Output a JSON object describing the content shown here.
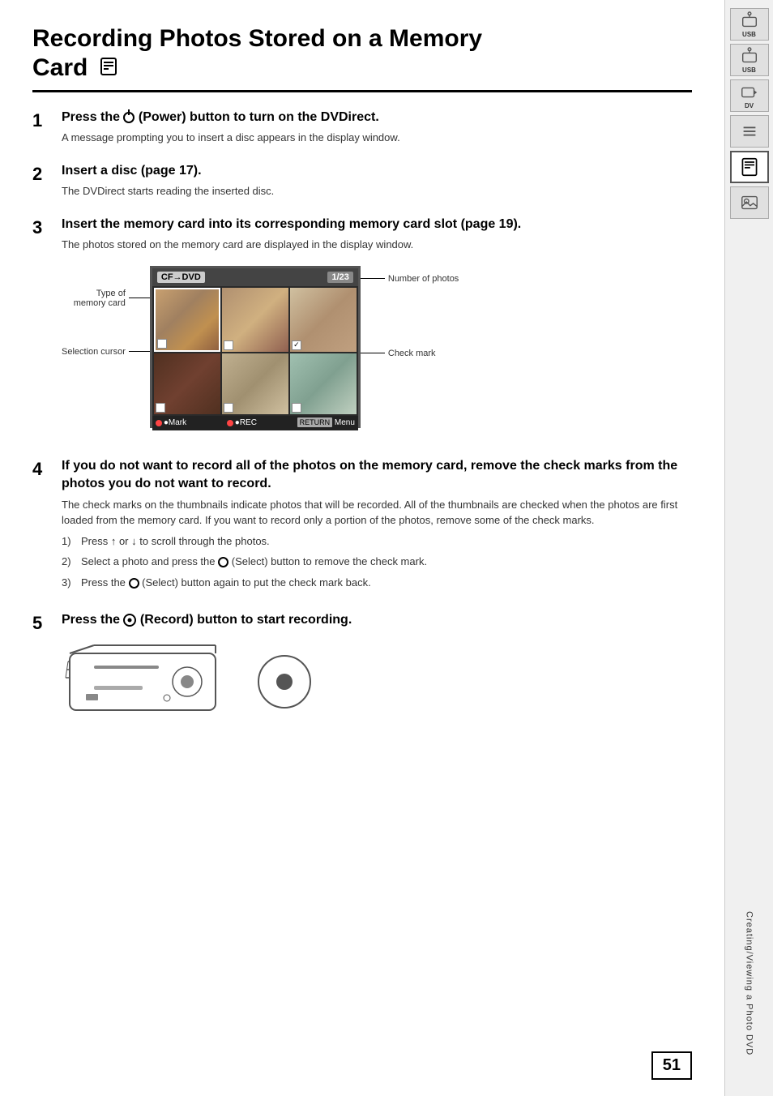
{
  "page": {
    "title_line1": "Recording Photos Stored on a Memory",
    "title_line2": "Card",
    "page_number": "51"
  },
  "sidebar": {
    "icons": [
      {
        "id": "usb-top",
        "label": "USB",
        "active": false
      },
      {
        "id": "usb-bottom",
        "label": "USB",
        "active": false
      },
      {
        "id": "dv",
        "label": "DV",
        "active": false
      },
      {
        "id": "lines",
        "label": "",
        "active": false
      },
      {
        "id": "card",
        "label": "",
        "active": true
      },
      {
        "id": "photo",
        "label": "",
        "active": false
      }
    ],
    "vertical_text": "Creating/Viewing a Photo DVD"
  },
  "steps": [
    {
      "number": "1",
      "heading": "Press the ⓨ (Power) button to turn on the DVDirect.",
      "description": "A message prompting you to insert a disc appears in the display window."
    },
    {
      "number": "2",
      "heading": "Insert a disc (page 17).",
      "description": "The DVDirect starts reading the inserted disc."
    },
    {
      "number": "3",
      "heading": "Insert the memory card into its corresponding memory card slot (page 19).",
      "description": "The photos stored on the memory card are displayed in the display window."
    },
    {
      "number": "4",
      "heading": "If you do not want to record all of the photos on the memory card, remove the check marks from the photos you do not want to record.",
      "description": "The check marks on the thumbnails indicate photos that will be recorded. All of the thumbnails are checked when the photos are first loaded from the memory card. If you want to record only a portion of the photos, remove some of the check marks.",
      "sub_items": [
        {
          "num": "1)",
          "text": "Press ↑ or ↓ to scroll through the photos."
        },
        {
          "num": "2)",
          "text": "Select a photo and press the ○ (Select) button to remove the check mark."
        },
        {
          "num": "3)",
          "text": "Press the ○ (Select) button again to put the check mark back."
        }
      ]
    },
    {
      "number": "5",
      "heading": "Press the ◎ (Record) button to start recording.",
      "description": ""
    }
  ],
  "diagram": {
    "label_type_memory": "Type of\nmemory card",
    "label_selection_cursor": "Selection cursor",
    "label_number_photos": "Number of photos",
    "label_check_mark": "Check mark",
    "screen_header_left": "CF→DVD",
    "screen_header_right": "1/23",
    "footer_mark": "●Mark",
    "footer_rec": "●REC",
    "footer_menu": "RETURN Menu"
  }
}
